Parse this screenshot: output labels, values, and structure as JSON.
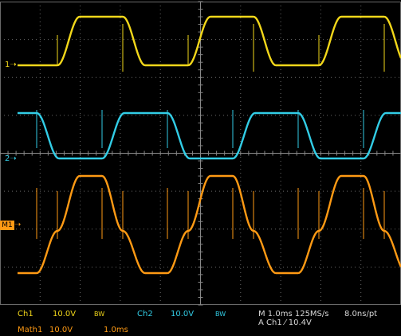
{
  "colors": {
    "ch1": "#f2d71a",
    "ch2": "#32cde6",
    "math1": "#ff9a14",
    "grid": "#6a6a6a",
    "text": "#d8d8d8",
    "background": "#000000"
  },
  "markers": {
    "ch1": "1",
    "ch2": "2",
    "math1": "M1"
  },
  "status": {
    "ch1_label": "Ch1",
    "ch1_scale": "10.0V",
    "ch1_bw": "BW",
    "ch2_label": "Ch2",
    "ch2_scale": "10.0V",
    "ch2_bw": "BW",
    "timebase": "M 1.0ms 125MS/s",
    "sample_interval": "8.0ns/pt",
    "trigger": "A  Ch1  ⁄  10.4V",
    "math1_label": "Math1",
    "math1_scale": "10.0V",
    "math1_time": "1.0ms"
  }
}
